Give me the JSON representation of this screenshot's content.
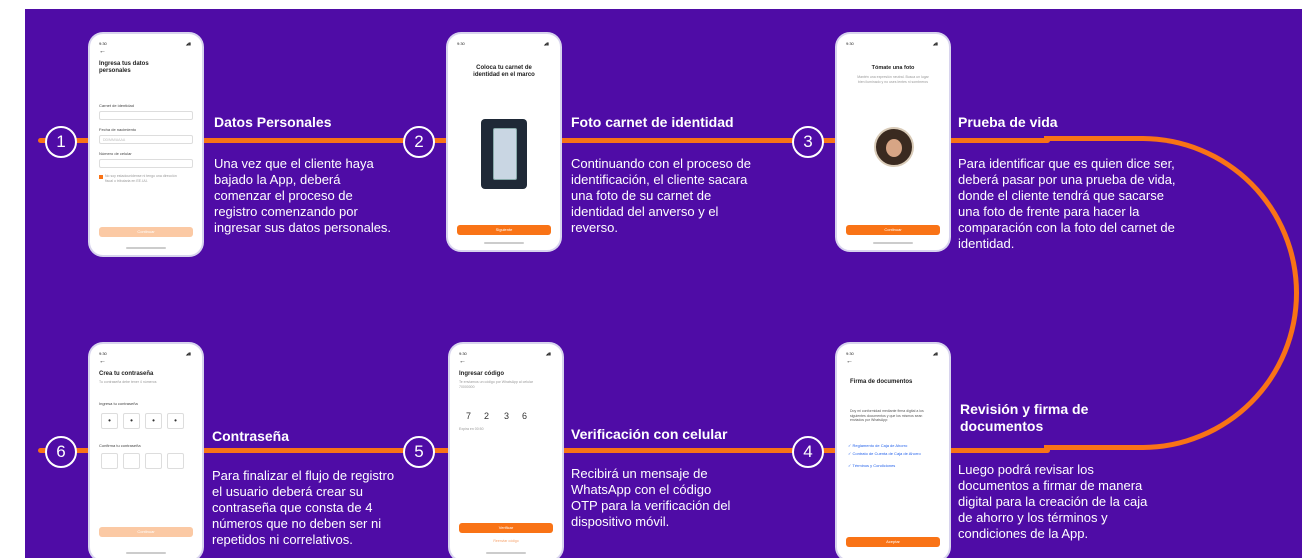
{
  "steps": [
    {
      "number": "1",
      "title": "Datos Personales",
      "description": "Una vez que el cliente haya bajado la App, deberá comenzar el proceso de registro comenzando por ingresar sus datos personales."
    },
    {
      "number": "2",
      "title": "Foto carnet de identidad",
      "description": "Continuando con el proceso de identificación, el cliente sacara una foto de su carnet de identidad del anverso y el reverso."
    },
    {
      "number": "3",
      "title": "Prueba de vida",
      "description": "Para identificar que es quien dice ser, deberá pasar por una prueba de vida, donde el cliente tendrá que sacarse una foto de frente para hacer la comparación con la foto del carnet de identidad."
    },
    {
      "number": "4",
      "title": "Revisión y firma de documentos",
      "description": "Luego podrá revisar los documentos a firmar de manera digital para la creación de la caja de ahorro y los términos y condiciones de la App."
    },
    {
      "number": "5",
      "title": "Verificación con celular",
      "description": "Recibirá un mensaje de WhatsApp con el código OTP para la verificación del dispositivo móvil."
    },
    {
      "number": "6",
      "title": "Contraseña",
      "description": "Para finalizar el flujo de registro el usuario deberá crear su contraseña que consta de 4 números que no deben ser ni repetidos ni correlativos."
    }
  ],
  "phones": {
    "common": {
      "time": "9:30",
      "signal": "◢▮"
    },
    "datos": {
      "title": "Ingresa tus datos personales",
      "field1_label": "Carnet de identidad",
      "field2_label": "Fecha de nacimiento",
      "field2_placeholder": "DD/MM/AAAA",
      "field3_label": "Número de celular",
      "checkbox_text": "No soy estadounidense ni tengo una dirección fiscal o tributaria en EE.UU.",
      "button": "Continuar"
    },
    "carnet": {
      "title": "Coloca tu carnet de identidad en el marco",
      "button": "Siguiente"
    },
    "vida": {
      "title": "Tómate una foto",
      "subtitle": "Mantén una expresión neutral. Busca un lugar bien iluminado y no uses lentes ni sombreros",
      "button": "Continuar"
    },
    "firma": {
      "title": "Firma de documentos",
      "text": "Doy mi conformidad mediante firma digital a los siguientes documentos y que los mismos sean enviados por WhatsApp:",
      "items": [
        "Reglamento de Caja de Ahorro",
        "Contrato de Cuenta de Caja de Ahorro",
        "Términos y Condiciones"
      ],
      "button": "Aceptar"
    },
    "codigo": {
      "title": "Ingresar código",
      "subtitle": "Te enviamos un código por WhatsApp al celular 70000000",
      "digits": [
        "7",
        "2",
        "3",
        "6"
      ],
      "expira": "Expira en 00:50",
      "button": "Verificar",
      "link": "Reenviar código"
    },
    "password": {
      "title": "Crea tu contraseña",
      "subtitle": "Tu contraseña debe tener 4 números",
      "label1": "Ingresa tu contraseña",
      "label2": "Confirma tu contraseña",
      "dot": "•",
      "button": "Continuar"
    }
  },
  "colors": {
    "background": "#4f0ca6",
    "accent": "#f97316",
    "text": "#ffffff"
  }
}
